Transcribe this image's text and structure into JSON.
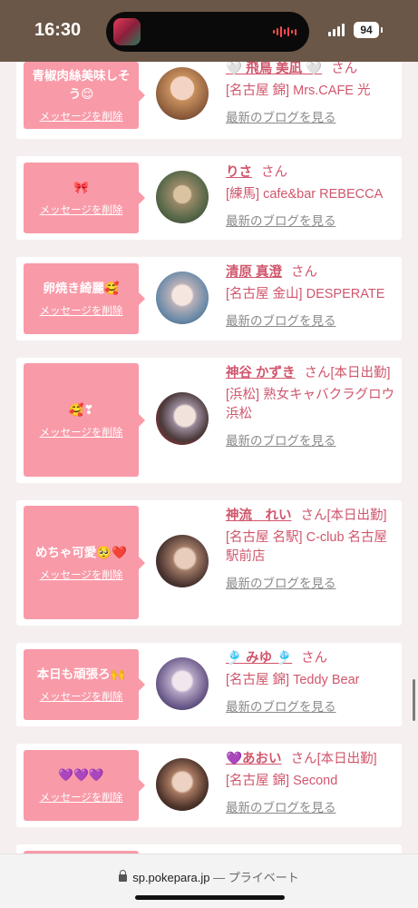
{
  "status_bar": {
    "time": "16:30",
    "battery": "94"
  },
  "browser": {
    "domain": "sp.pokepara.jp",
    "separator": "—",
    "mode": "プライベート"
  },
  "common": {
    "delete_label": "メッセージを削除",
    "blog_label": "最新のブログを見る",
    "san": "さん"
  },
  "messages": [
    {
      "message": "青椒肉絲美味しそう😌",
      "name": "🤍 飛鳥 美凪 🤍",
      "status": "",
      "shop": "[名古屋 錦] Mrs.CAFE 光"
    },
    {
      "message": "🎀",
      "name": "りさ",
      "status": "",
      "shop": "[練馬] cafe&bar REBECCA"
    },
    {
      "message": "卵焼き綺麗🥰",
      "name": "清原 真澄",
      "status": "",
      "shop": "[名古屋 金山] DESPERATE"
    },
    {
      "message": "🥰❣",
      "name": "神谷 かずき",
      "status": "[本日出勤]",
      "shop": "[浜松] 熟女キャバクラグロウ 浜松"
    },
    {
      "message": "めちゃ可愛🥺❤️",
      "name": "神流　れい",
      "status": "[本日出勤]",
      "shop": "[名古屋 名駅] C-club 名古屋駅前店"
    },
    {
      "message": "本日も頑張ろ🙌",
      "name": "🎐 みゆ 🎐",
      "status": "",
      "shop": "[名古屋 錦] Teddy Bear"
    },
    {
      "message": "💜💜💜",
      "name": "💜あおい",
      "status": "[本日出勤]",
      "shop": "[名古屋 錦] Second"
    }
  ],
  "colors": {
    "accent": "#d0566c",
    "bubble": "#f99aa8",
    "status_bar": "#6b5747",
    "background": "#f6efef"
  }
}
